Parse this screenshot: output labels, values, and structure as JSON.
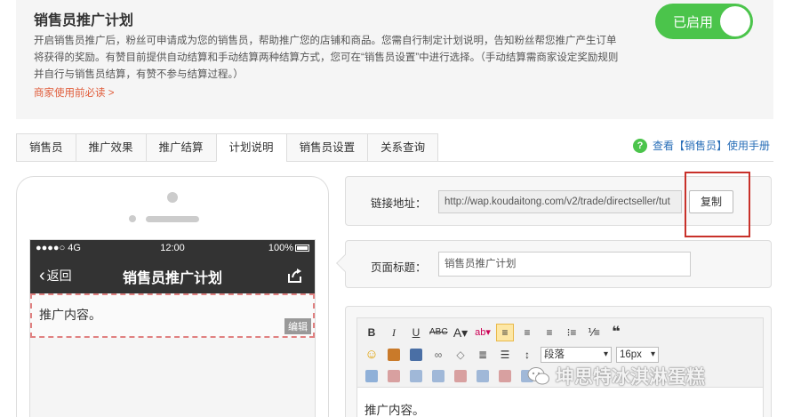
{
  "info": {
    "title": "销售员推广计划",
    "desc": "开启销售员推广后，粉丝可申请成为您的销售员，帮助推广您的店铺和商品。您需自行制定计划说明，告知粉丝帮您推广产生订单将获得的奖励。有赞目前提供自动结算和手动结算两种结算方式，您可在“销售员设置”中进行选择。（手动结算需商家设定奖励规则并自行与销售员结算，有赞不参与结算过程。）",
    "link": "商家使用前必读 >",
    "toggle_label": "已启用"
  },
  "tabs": [
    "销售员",
    "推广效果",
    "推广结算",
    "计划说明",
    "销售员设置",
    "关系查询"
  ],
  "active_tab_index": 3,
  "help": {
    "icon": "?",
    "text": "查看【销售员】使用手册"
  },
  "phone": {
    "status_left": "●●●●○ 4G",
    "status_time": "12:00",
    "status_right": "100%",
    "back_label": "返回",
    "nav_title": "销售员推广计划",
    "content_text": "推广内容。",
    "edit_badge": "编辑"
  },
  "settings": {
    "link_label": "链接地址：",
    "link_value": "http://wap.koudaitong.com/v2/trade/directseller/tut",
    "copy_label": "复制",
    "title_label": "页面标题：",
    "title_value": "销售员推广计划"
  },
  "editor": {
    "font_format": "段落",
    "font_size": "16px",
    "content": "推广内容。"
  },
  "watermark": "坤思特冰淇淋蛋糕",
  "colors": {
    "accent_green": "#4bc44b",
    "highlight_red": "#c8312a",
    "link_orange": "#e05c3a"
  }
}
